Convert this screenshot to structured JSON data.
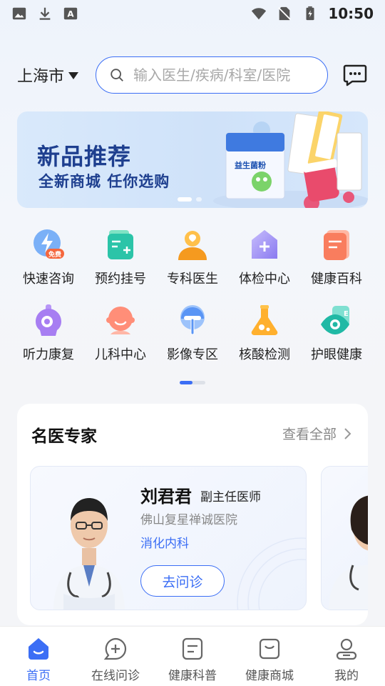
{
  "status_bar": {
    "time": "10:50"
  },
  "header": {
    "city": "上海市",
    "search_placeholder": "输入医生/疾病/科室/医院"
  },
  "banner": {
    "title": "新品推荐",
    "subtitle": "全新商城  任你选购",
    "dots": 2,
    "active_dot": 0,
    "product_label": "益生菌粉"
  },
  "services": [
    {
      "label": "快速咨询",
      "icon": "lightning-icon",
      "badge": "免费"
    },
    {
      "label": "预约挂号",
      "icon": "register-icon"
    },
    {
      "label": "专科医生",
      "icon": "doctor-icon"
    },
    {
      "label": "体检中心",
      "icon": "checkup-icon"
    },
    {
      "label": "健康百科",
      "icon": "encyclopedia-icon"
    },
    {
      "label": "听力康复",
      "icon": "hearing-icon"
    },
    {
      "label": "儿科中心",
      "icon": "pediatric-icon"
    },
    {
      "label": "影像专区",
      "icon": "imaging-icon"
    },
    {
      "label": "核酸检测",
      "icon": "flask-icon"
    },
    {
      "label": "护眼健康",
      "icon": "eye-icon"
    }
  ],
  "experts": {
    "title": "名医专家",
    "view_all": "查看全部",
    "doctors": [
      {
        "name": "刘君君",
        "title": "副主任医师",
        "hospital": "佛山复星禅诚医院",
        "department": "消化内科",
        "button": "去问诊"
      }
    ]
  },
  "tabbar": {
    "active": 0,
    "items": [
      {
        "label": "首页",
        "icon": "home-icon"
      },
      {
        "label": "在线问诊",
        "icon": "consult-icon"
      },
      {
        "label": "健康科普",
        "icon": "article-icon"
      },
      {
        "label": "健康商城",
        "icon": "shop-icon"
      },
      {
        "label": "我的",
        "icon": "profile-icon"
      }
    ]
  },
  "colors": {
    "accent": "#3b6ef5",
    "banner_text": "#1e3f8f"
  }
}
